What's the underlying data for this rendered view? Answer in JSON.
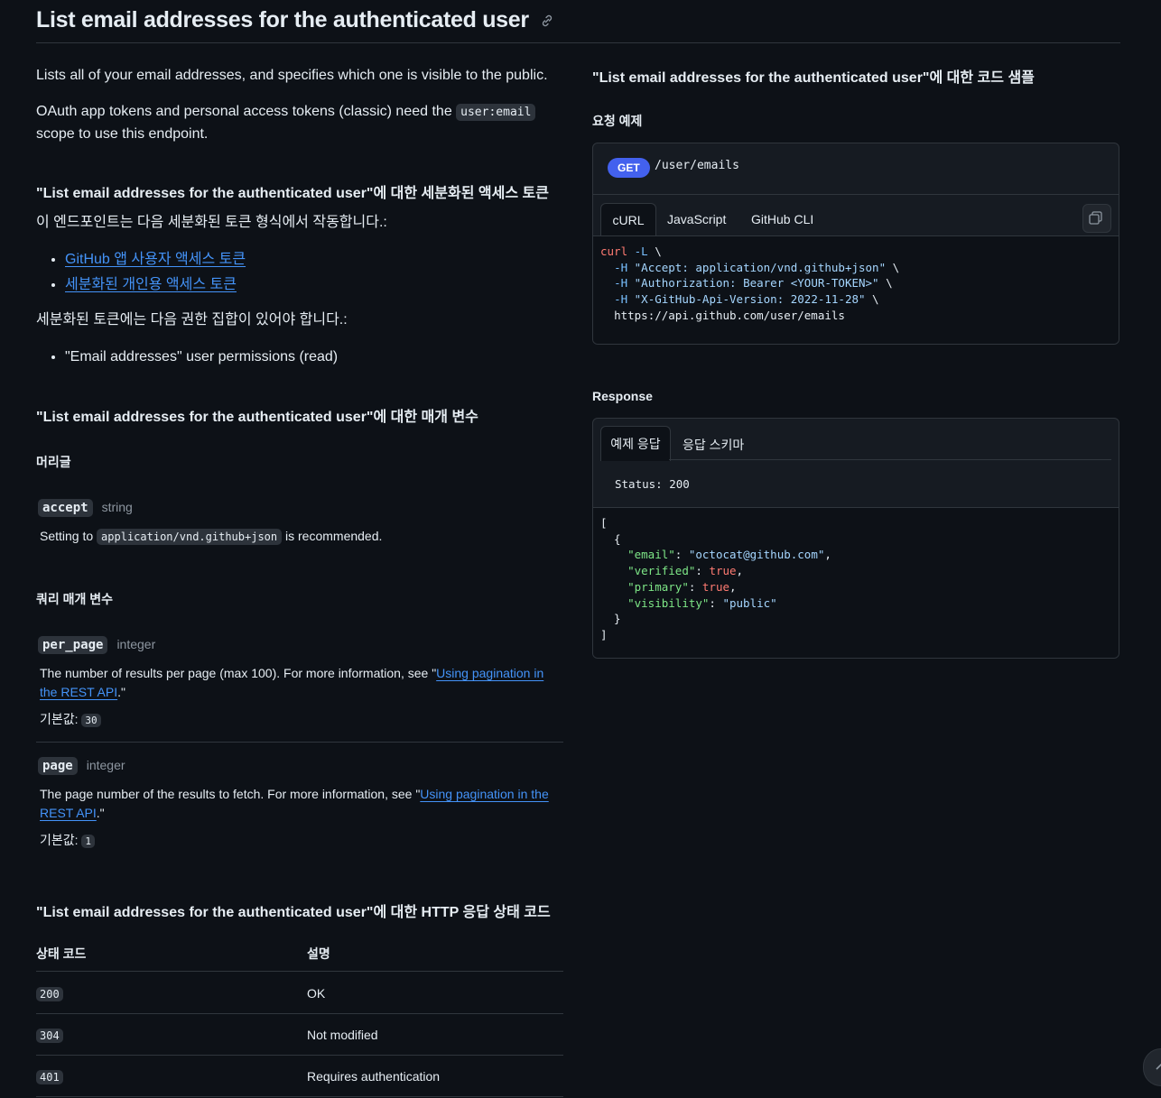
{
  "title": "List email addresses for the authenticated user",
  "intro": "Lists all of your email addresses, and specifies which one is visible to the public.",
  "oauth": {
    "before": "OAuth app tokens and personal access tokens (classic) need the ",
    "scope": "user:email",
    "after": " scope to use this endpoint."
  },
  "fine_grained": {
    "heading": "\"List email addresses for the authenticated user\"에 대한 세분화된 액세스 토큰",
    "desc": "이 엔드포인트는 다음 세분화된 토큰 형식에서 작동합니다.:",
    "token_types": [
      "GitHub 앱 사용자 액세스 토큰",
      "세분화된 개인용 액세스 토큰"
    ],
    "perm_desc": "세분화된 토큰에는 다음 권한 집합이 있어야 합니다.:",
    "permissions": [
      "\"Email addresses\" user permissions (read)"
    ]
  },
  "params": {
    "heading": "\"List email addresses for the authenticated user\"에 대한 매개 변수",
    "headers_label": "머리글",
    "accept": {
      "name": "accept",
      "type": "string",
      "desc_before": "Setting to ",
      "desc_code": "application/vnd.github+json",
      "desc_after": " is recommended."
    },
    "query_label": "쿼리 매개 변수",
    "per_page": {
      "name": "per_page",
      "type": "integer",
      "desc_before": "The number of results per page (max 100). For more information, see \"",
      "link": "Using pagination in the REST API",
      "desc_after": ".\"",
      "default_label": "기본값:",
      "default": "30"
    },
    "page": {
      "name": "page",
      "type": "integer",
      "desc_before": "The page number of the results to fetch. For more information, see \"",
      "link": "Using pagination in the REST API",
      "desc_after": ".\"",
      "default_label": "기본값:",
      "default": "1"
    }
  },
  "status_codes": {
    "heading": "\"List email addresses for the authenticated user\"에 대한 HTTP 응답 상태 코드",
    "col_code": "상태 코드",
    "col_desc": "설명",
    "rows": [
      {
        "code": "200",
        "desc": "OK"
      },
      {
        "code": "304",
        "desc": "Not modified"
      },
      {
        "code": "401",
        "desc": "Requires authentication"
      }
    ]
  },
  "samples": {
    "heading": "\"List email addresses for the authenticated user\"에 대한 코드 샘플",
    "request_label": "요청 예제",
    "method": "GET",
    "path": "/user/emails",
    "tabs": [
      "cURL",
      "JavaScript",
      "GitHub CLI"
    ],
    "curl": {
      "cmd": "curl",
      "flagL": "-L",
      "h1": "\"Accept: application/vnd.github+json\"",
      "h2": "\"Authorization: Bearer <YOUR-TOKEN>\"",
      "h3": "\"X-GitHub-Api-Version: 2022-11-28\"",
      "url": "https://api.github.com/user/emails"
    }
  },
  "response": {
    "heading": "Response",
    "tabs": [
      "예제 응답",
      "응답 스키마"
    ],
    "status": "Status: 200",
    "json": {
      "email": "\"octocat@github.com\"",
      "verified": "true",
      "primary": "true",
      "visibility": "\"public\""
    }
  },
  "colors": {
    "bg": "#0d1117",
    "panel": "#161b22",
    "link": "#4493f8",
    "get_badge": "#4361ee"
  }
}
